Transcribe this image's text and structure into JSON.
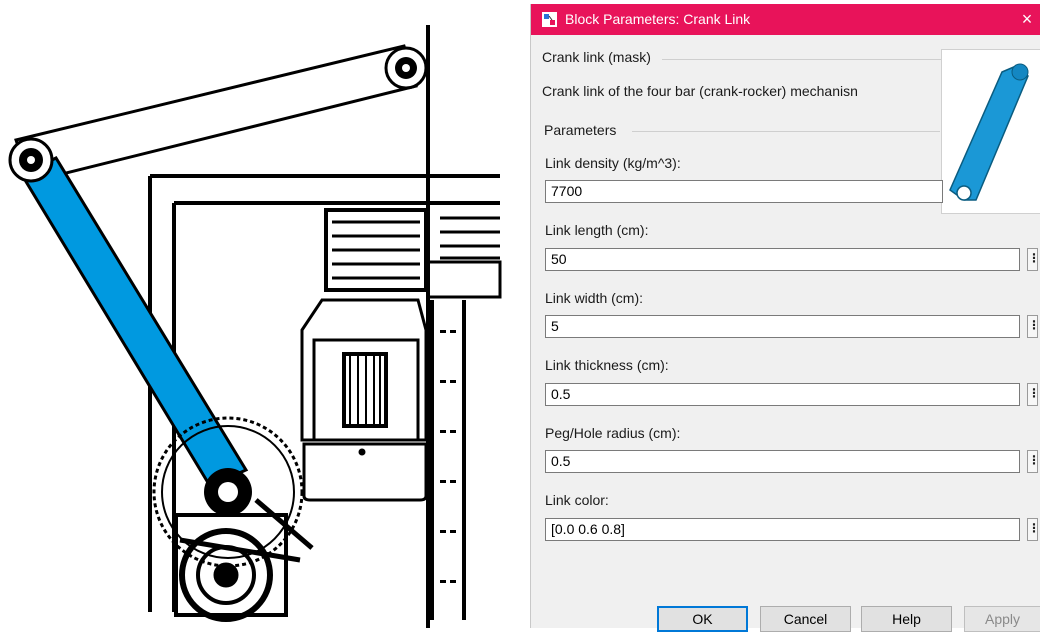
{
  "dialog": {
    "title": "Block Parameters: Crank Link",
    "close_glyph": "×",
    "title_bar_color": "#e8135a",
    "mask_title": "Crank link (mask)",
    "mask_description": "Crank link of the four bar (crank-rocker) mechanisn",
    "parameters_legend": "Parameters",
    "fields": [
      {
        "label": "Link density (kg/m^3):",
        "value": "7700"
      },
      {
        "label": "Link length (cm):",
        "value": "50"
      },
      {
        "label": "Link width (cm):",
        "value": "5"
      },
      {
        "label": "Link thickness (cm):",
        "value": "0.5"
      },
      {
        "label": "Peg/Hole radius (cm):",
        "value": "0.5"
      },
      {
        "label": "Link color:",
        "value": "[0.0 0.6 0.8]"
      }
    ],
    "more_glyph": "⋮",
    "buttons": {
      "ok": "OK",
      "cancel": "Cancel",
      "help": "Help",
      "apply": "Apply"
    }
  },
  "drawing": {
    "link_color": "#0099e0",
    "mask_image_color": "#1b98d6"
  }
}
